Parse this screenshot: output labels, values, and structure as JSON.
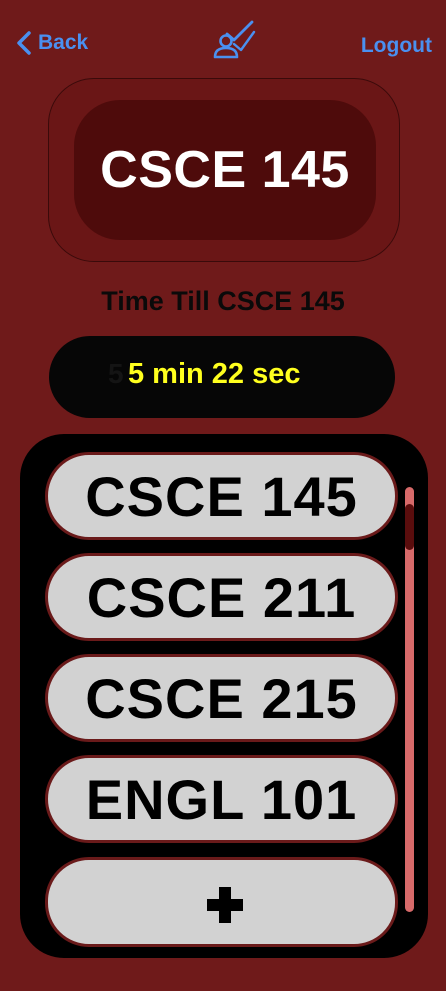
{
  "nav": {
    "back_label": "Back",
    "logout_label": "Logout",
    "logo_icon": "user-checkmark-icon",
    "link_color": "#4a90f0"
  },
  "current_class": {
    "title": "CSCE 145"
  },
  "countdown": {
    "label": "Time Till CSCE 145",
    "ghost_text": "5",
    "value": "5 min 22 sec",
    "value_color": "#ffff1e"
  },
  "course_list": {
    "items": [
      {
        "label": "CSCE 145"
      },
      {
        "label": "CSCE 211"
      },
      {
        "label": "CSCE 215"
      },
      {
        "label": "ENGL 101"
      }
    ],
    "add_icon": "plus-icon"
  },
  "colors": {
    "background": "#6f1a1a",
    "pill_dark": "#4e0b0b",
    "item_bg": "#d2d2d2",
    "scroll_track": "#d76a6a"
  }
}
